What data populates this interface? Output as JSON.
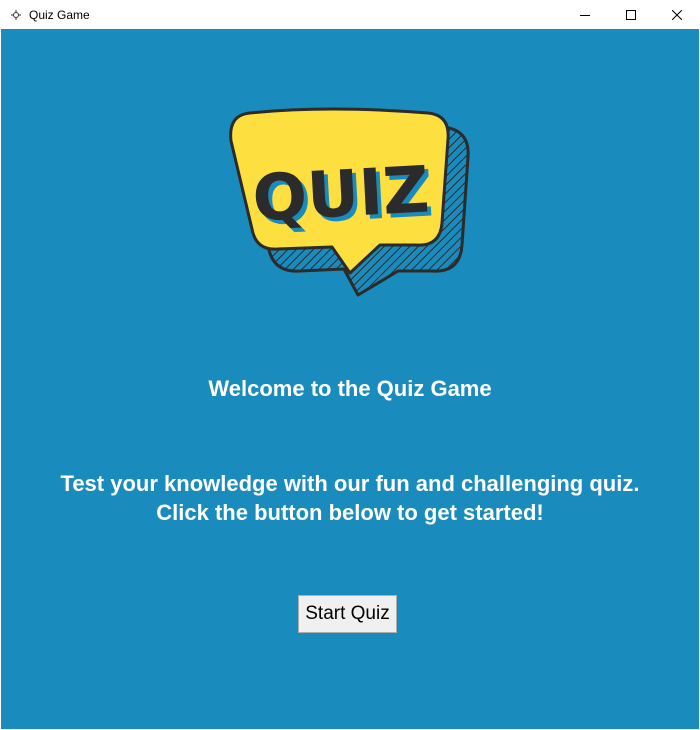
{
  "window": {
    "title": "Quiz Game",
    "icons": {
      "app": "feather-icon",
      "minimize": "minimize-icon",
      "maximize": "maximize-icon",
      "close": "close-icon"
    }
  },
  "main": {
    "logo_text": "QUIZ",
    "welcome": "Welcome to the Quiz Game",
    "description_line1": "Test your knowledge with our fun and challenging quiz.",
    "description_line2": "Click the button below to get started!",
    "start_button": "Start Quiz"
  },
  "colors": {
    "background": "#1a8bbd",
    "logo_yellow": "#fde03f",
    "logo_outline": "#2b2b2b",
    "text": "#ffffff"
  }
}
